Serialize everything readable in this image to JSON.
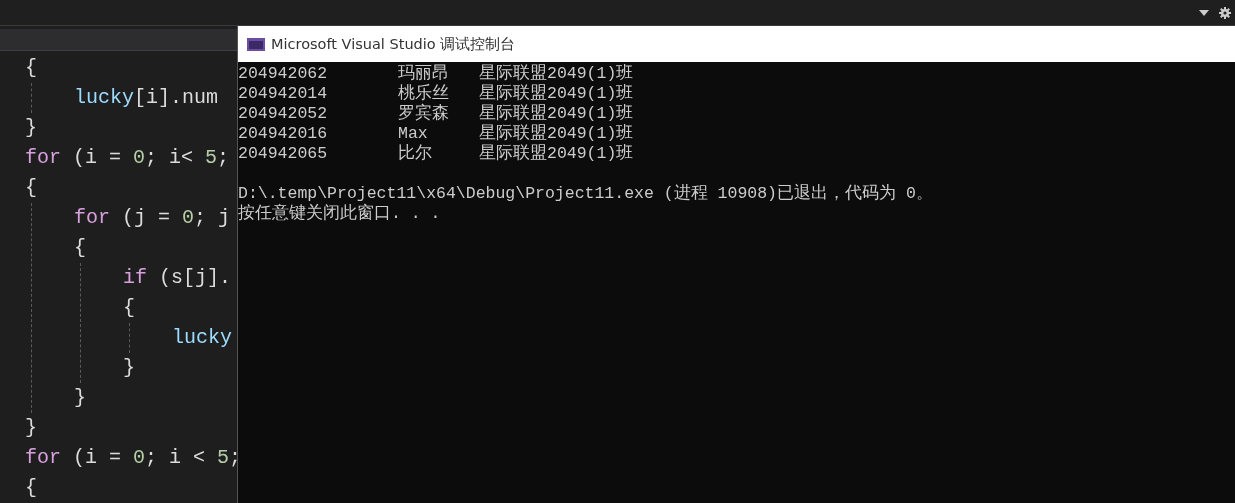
{
  "editor": {
    "lines": [
      {
        "tokens": [
          {
            "kind": "punct",
            "text": "{"
          }
        ]
      },
      {
        "children": [
          {
            "tokens": [
              {
                "kind": "var",
                "text": "lucky"
              },
              {
                "kind": "punct",
                "text": "[i].num"
              }
            ]
          }
        ]
      },
      {
        "tokens": [
          {
            "kind": "punct",
            "text": "}"
          }
        ]
      },
      {
        "tokens": [
          {
            "kind": "keyword",
            "text": "for"
          },
          {
            "kind": "punct",
            "text": " (i = "
          },
          {
            "kind": "number",
            "text": "0"
          },
          {
            "kind": "punct",
            "text": "; i< "
          },
          {
            "kind": "number",
            "text": "5"
          },
          {
            "kind": "punct",
            "text": ";"
          }
        ]
      },
      {
        "tokens": [
          {
            "kind": "punct",
            "text": "{"
          }
        ]
      },
      {
        "children": [
          {
            "tokens": [
              {
                "kind": "keyword",
                "text": "for"
              },
              {
                "kind": "punct",
                "text": " (j = "
              },
              {
                "kind": "number",
                "text": "0"
              },
              {
                "kind": "punct",
                "text": "; j"
              }
            ]
          },
          {
            "tokens": [
              {
                "kind": "punct",
                "text": "{"
              }
            ]
          },
          {
            "children": [
              {
                "tokens": [
                  {
                    "kind": "keyword",
                    "text": "if"
                  },
                  {
                    "kind": "punct",
                    "text": " (s[j]."
                  }
                ]
              },
              {
                "tokens": [
                  {
                    "kind": "punct",
                    "text": "{"
                  }
                ]
              },
              {
                "children": [
                  {
                    "tokens": [
                      {
                        "kind": "var",
                        "text": "lucky"
                      }
                    ]
                  }
                ]
              },
              {
                "tokens": [
                  {
                    "kind": "punct",
                    "text": "}"
                  }
                ]
              }
            ]
          },
          {
            "tokens": [
              {
                "kind": "punct",
                "text": "}"
              }
            ]
          }
        ]
      },
      {
        "tokens": [
          {
            "kind": "punct",
            "text": "}"
          }
        ]
      },
      {
        "tokens": [
          {
            "kind": "keyword",
            "text": "for"
          },
          {
            "kind": "punct",
            "text": " (i = "
          },
          {
            "kind": "number",
            "text": "0"
          },
          {
            "kind": "punct",
            "text": "; i < "
          },
          {
            "kind": "number",
            "text": "5"
          },
          {
            "kind": "punct",
            "text": ";"
          }
        ]
      },
      {
        "tokens": [
          {
            "kind": "punct",
            "text": "{"
          }
        ]
      }
    ]
  },
  "console": {
    "title": "Microsoft Visual Studio 调试控制台",
    "rows": [
      {
        "id": "204942062",
        "name": "玛丽昂",
        "class": "星际联盟2049(1)班"
      },
      {
        "id": "204942014",
        "name": "桃乐丝",
        "class": "星际联盟2049(1)班"
      },
      {
        "id": "204942052",
        "name": "罗宾森",
        "class": "星际联盟2049(1)班"
      },
      {
        "id": "204942016",
        "name": "Max",
        "class": "星际联盟2049(1)班"
      },
      {
        "id": "204942065",
        "name": "比尔",
        "class": "星际联盟2049(1)班"
      }
    ],
    "exit_message": "D:\\.temp\\Project11\\x64\\Debug\\Project11.exe (进程 10908)已退出，代码为 0。",
    "prompt": "按任意键关闭此窗口. . ."
  }
}
